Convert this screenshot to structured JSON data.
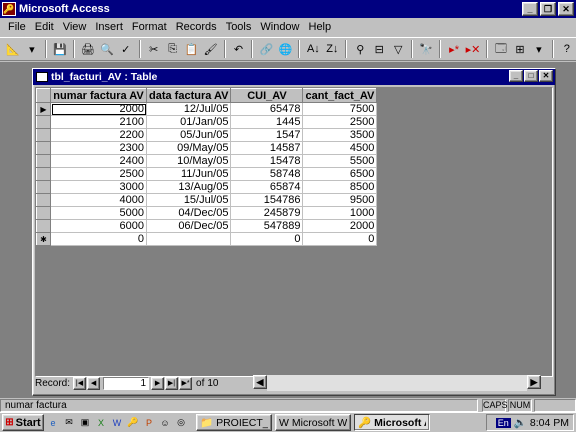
{
  "app": {
    "title": "Microsoft Access"
  },
  "menu": [
    "File",
    "Edit",
    "View",
    "Insert",
    "Format",
    "Records",
    "Tools",
    "Window",
    "Help"
  ],
  "table_window": {
    "title": "tbl_facturi_AV : Table",
    "columns": [
      "numar factura AV",
      "data factura AV",
      "CUI_AV",
      "cant_fact_AV"
    ],
    "rows": [
      [
        "2000",
        "12/Jul/05",
        "65478",
        "7500"
      ],
      [
        "2100",
        "01/Jan/05",
        "1445",
        "2500"
      ],
      [
        "2200",
        "05/Jun/05",
        "1547",
        "3500"
      ],
      [
        "2300",
        "09/May/05",
        "14587",
        "4500"
      ],
      [
        "2400",
        "10/May/05",
        "15478",
        "5500"
      ],
      [
        "2500",
        "11/Jun/05",
        "58748",
        "6500"
      ],
      [
        "3000",
        "13/Aug/05",
        "65874",
        "8500"
      ],
      [
        "4000",
        "15/Jul/05",
        "154786",
        "9500"
      ],
      [
        "5000",
        "04/Dec/05",
        "245879",
        "1000"
      ],
      [
        "6000",
        "06/Dec/05",
        "547889",
        "2000"
      ]
    ],
    "new_row": [
      "0",
      "",
      "0",
      "0"
    ],
    "nav": {
      "label": "Record:",
      "current": "1",
      "of_label": "of",
      "total": "10"
    }
  },
  "status": {
    "text": "numar factura",
    "caps": "CAPS",
    "num": "NUM"
  },
  "taskbar": {
    "start": "Start",
    "tasks": [
      {
        "label": "PROIECT_AV",
        "icon": "folder-icon"
      },
      {
        "label": "Microsoft Word ...",
        "icon": "word-icon"
      },
      {
        "label": "Microsoft Ac...",
        "icon": "access-icon"
      }
    ],
    "lang": "En",
    "clock": "8:04 PM"
  },
  "colors": {
    "title_bg": "#000080",
    "desktop_mdi": "#808080",
    "face": "#c0c0c0"
  }
}
